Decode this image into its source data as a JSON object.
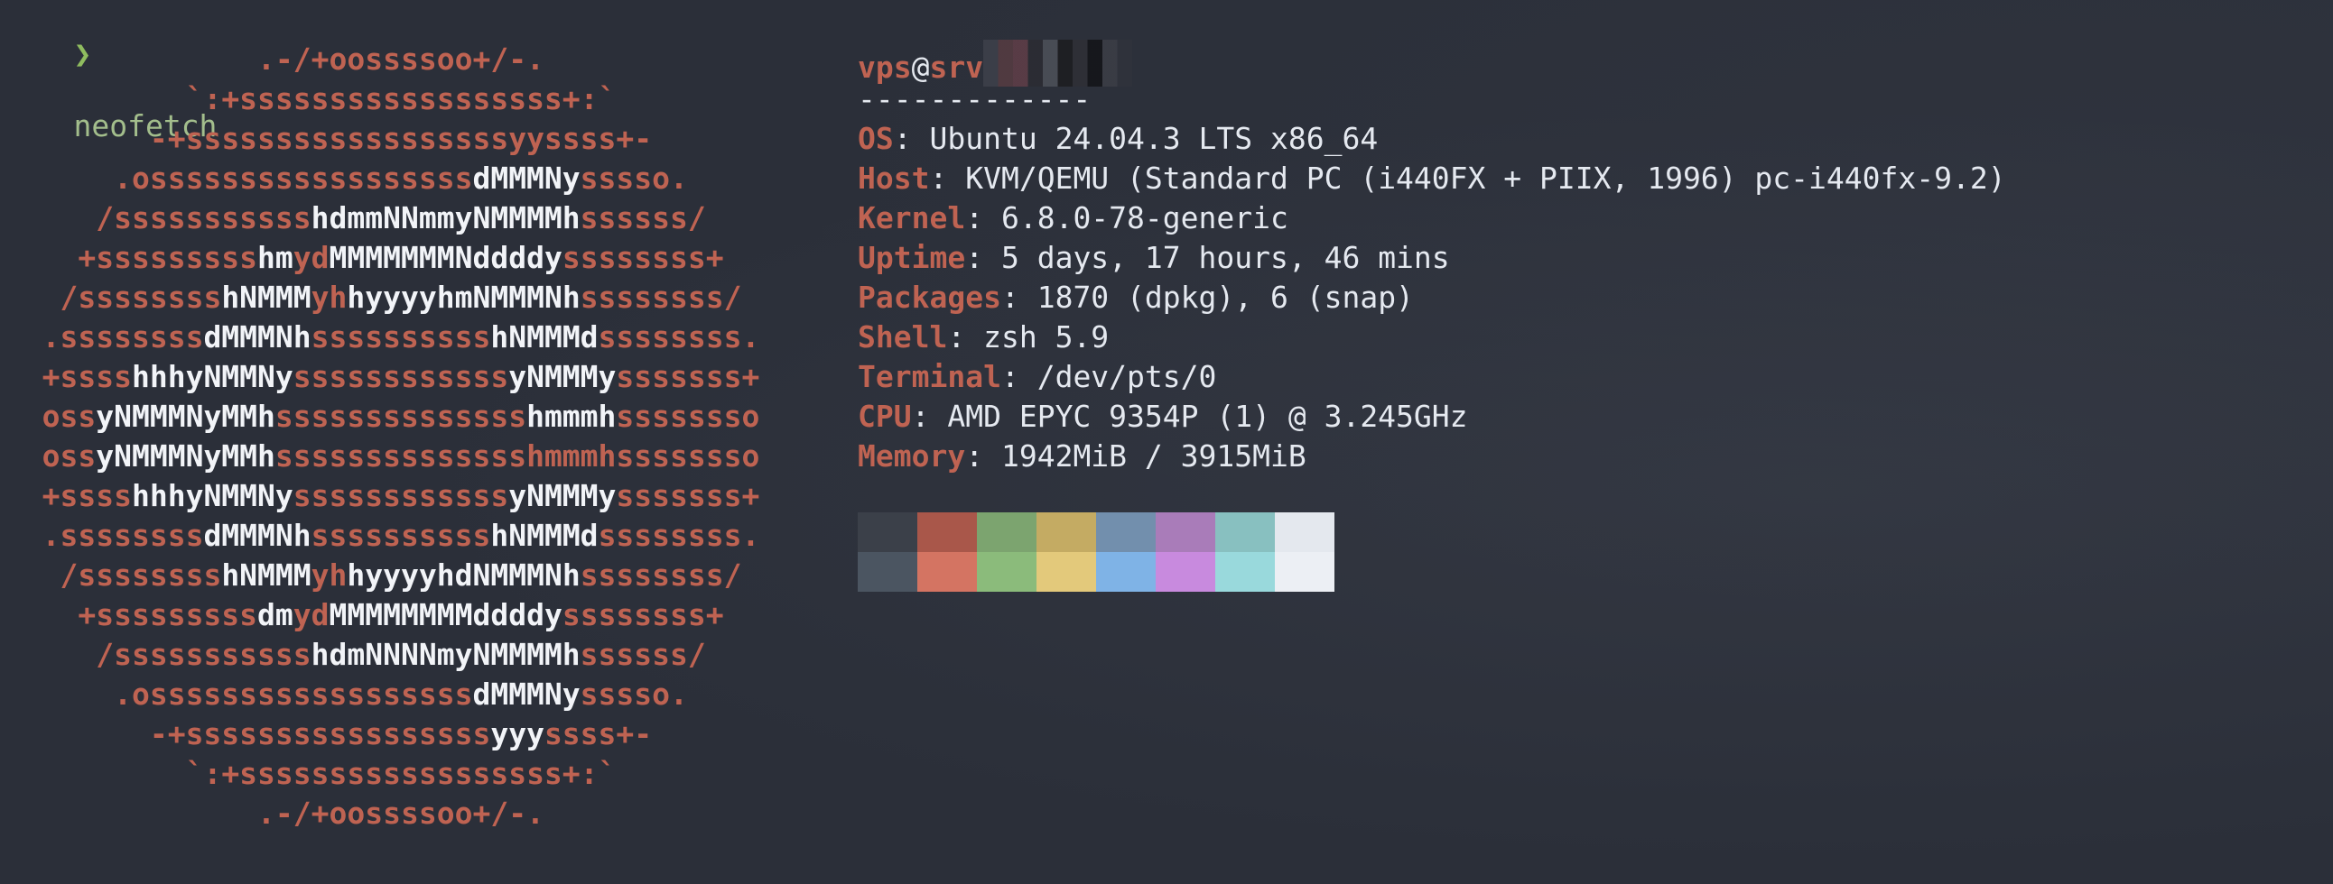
{
  "prompt": {
    "arrow": "❯",
    "command": "neofetch"
  },
  "logo_lines": [
    [
      [
        "c1",
        ".-/+oossssoo+/-."
      ]
    ],
    [
      [
        "c1",
        "`:+ssssssssssssssssss+:`"
      ]
    ],
    [
      [
        "c1",
        "-+ssssssssssssssssssyyssss+-"
      ]
    ],
    [
      [
        "c1",
        ".ossssssssssssssssss"
      ],
      [
        "c2",
        "dMMMNy"
      ],
      [
        "c1",
        "sssso."
      ]
    ],
    [
      [
        "c1",
        "/sssssssssss"
      ],
      [
        "c2",
        "hdmmNNmmyNMMMMh"
      ],
      [
        "c1",
        "ssssss/"
      ]
    ],
    [
      [
        "c1",
        "+sssssssss"
      ],
      [
        "c2",
        "hm"
      ],
      [
        "c1",
        "yd"
      ],
      [
        "c2",
        "MMMMMMMNddddy"
      ],
      [
        "c1",
        "ssssssss+"
      ]
    ],
    [
      [
        "c1",
        "/ssssssss"
      ],
      [
        "c2",
        "hNMMM"
      ],
      [
        "c1",
        "yh"
      ],
      [
        "c2",
        "hyyyyhmNMMMNh"
      ],
      [
        "c1",
        "ssssssss/"
      ]
    ],
    [
      [
        "c1",
        ".ssssssss"
      ],
      [
        "c2",
        "dMMMNh"
      ],
      [
        "c1",
        "ssssssssss"
      ],
      [
        "c2",
        "hNMMMd"
      ],
      [
        "c1",
        "ssssssss."
      ]
    ],
    [
      [
        "c1",
        "+ssss"
      ],
      [
        "c2",
        "hhhyNMMNy"
      ],
      [
        "c1",
        "ssssssssssss"
      ],
      [
        "c2",
        "yNMMMy"
      ],
      [
        "c1",
        "sssssss+"
      ]
    ],
    [
      [
        "c1",
        "oss"
      ],
      [
        "c2",
        "yNMMMNyMMh"
      ],
      [
        "c1",
        "ssssssssssssss"
      ],
      [
        "c2",
        "hmmmh"
      ],
      [
        "c1",
        "ssssssso"
      ]
    ],
    [
      [
        "c1",
        "oss"
      ],
      [
        "c2",
        "yNMMMNyMMh"
      ],
      [
        "c1",
        "sssssssssssssshmmmhssssssso"
      ]
    ],
    [
      [
        "c1",
        "+ssss"
      ],
      [
        "c2",
        "hhhyNMMNy"
      ],
      [
        "c1",
        "ssssssssssss"
      ],
      [
        "c2",
        "yNMMMy"
      ],
      [
        "c1",
        "sssssss+"
      ]
    ],
    [
      [
        "c1",
        ".ssssssss"
      ],
      [
        "c2",
        "dMMMNh"
      ],
      [
        "c1",
        "ssssssssss"
      ],
      [
        "c2",
        "hNMMMd"
      ],
      [
        "c1",
        "ssssssss."
      ]
    ],
    [
      [
        "c1",
        "/ssssssss"
      ],
      [
        "c2",
        "hNMMM"
      ],
      [
        "c1",
        "yh"
      ],
      [
        "c2",
        "hyyyyhdNMMMNh"
      ],
      [
        "c1",
        "ssssssss/"
      ]
    ],
    [
      [
        "c1",
        "+sssssssss"
      ],
      [
        "c2",
        "dm"
      ],
      [
        "c1",
        "yd"
      ],
      [
        "c2",
        "MMMMMMMMddddy"
      ],
      [
        "c1",
        "ssssssss+"
      ]
    ],
    [
      [
        "c1",
        "/sssssssssss"
      ],
      [
        "c2",
        "hdmNNNNmyNMMMMh"
      ],
      [
        "c1",
        "ssssss/"
      ]
    ],
    [
      [
        "c1",
        ".ossssssssssssssssss"
      ],
      [
        "c2",
        "dMMMNy"
      ],
      [
        "c1",
        "sssso."
      ]
    ],
    [
      [
        "c1",
        "-+sssssssssssssssss"
      ],
      [
        "c2",
        "yyy"
      ],
      [
        "c1",
        "ssss+-"
      ]
    ],
    [
      [
        "c1",
        "`:+ssssssssssssssssss+:`"
      ]
    ],
    [
      [
        "c1",
        ".-/+oossssoo+/-."
      ]
    ]
  ],
  "info": {
    "user": "vps",
    "at": "@",
    "host": "srv",
    "separator": "-------------",
    "rows": [
      {
        "key": "OS",
        "value": "Ubuntu 24.04.3 LTS x86_64"
      },
      {
        "key": "Host",
        "value": "KVM/QEMU (Standard PC (i440FX + PIIX, 1996) pc-i440fx-9.2)"
      },
      {
        "key": "Kernel",
        "value": "6.8.0-78-generic"
      },
      {
        "key": "Uptime",
        "value": "5 days, 17 hours, 46 mins"
      },
      {
        "key": "Packages",
        "value": "1870 (dpkg), 6 (snap)"
      },
      {
        "key": "Shell",
        "value": "zsh 5.9"
      },
      {
        "key": "Terminal",
        "value": "/dev/pts/0"
      },
      {
        "key": "CPU",
        "value": "AMD EPYC 9354P (1) @ 3.245GHz"
      },
      {
        "key": "Memory",
        "value": "1942MiB / 3915MiB"
      }
    ]
  },
  "colors": {
    "background": "#2b2f39",
    "accent": "#bf6352",
    "logo_secondary": "#f2f4f8",
    "prompt_green": "#8fbc5f"
  },
  "palette": {
    "normal": [
      "#3b4049",
      "#a9574a",
      "#7ca46f",
      "#c4ab63",
      "#728fad",
      "#a97cb9",
      "#88c0c0",
      "#e4e8ee"
    ],
    "bright": [
      "#4b5561",
      "#d47462",
      "#8bbb7b",
      "#e3c97b",
      "#7fb3e6",
      "#c88ade",
      "#99d9dc",
      "#eceff4"
    ]
  }
}
